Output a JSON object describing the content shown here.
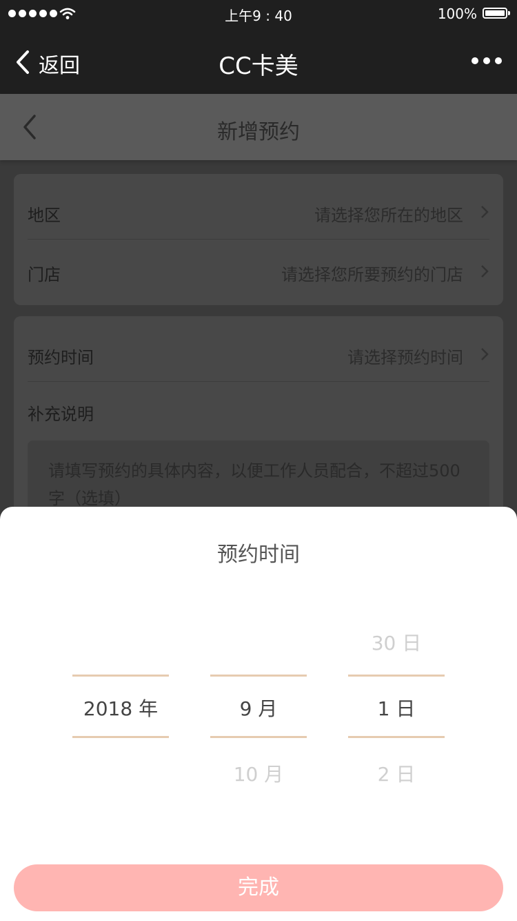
{
  "status_bar": {
    "time": "上午9 : 40",
    "battery": "100%"
  },
  "nav": {
    "back_label": "返回",
    "title": "CC卡美"
  },
  "page": {
    "title": "新增预约"
  },
  "form": {
    "region_label": "地区",
    "region_placeholder": "请选择您所在的地区",
    "store_label": "门店",
    "store_placeholder": "请选择您所要预约的门店",
    "time_label": "预约时间",
    "time_placeholder": "请选择预约时间",
    "note_label": "补充说明",
    "note_placeholder": "请填写预约的具体内容，以便工作人员配合，不超过500字（选填）"
  },
  "picker": {
    "title": "预约时间",
    "year": {
      "above": "",
      "selected": "2018 年",
      "below": ""
    },
    "month": {
      "above": "",
      "selected": "9 月",
      "below": "10 月"
    },
    "day": {
      "above": "30 日",
      "selected": "1 日",
      "below": "2 日"
    },
    "done_label": "完成"
  },
  "colors": {
    "accent_line": "#e6cbb0",
    "button": "#ffb5b2",
    "navbar": "#1f1f1f"
  }
}
